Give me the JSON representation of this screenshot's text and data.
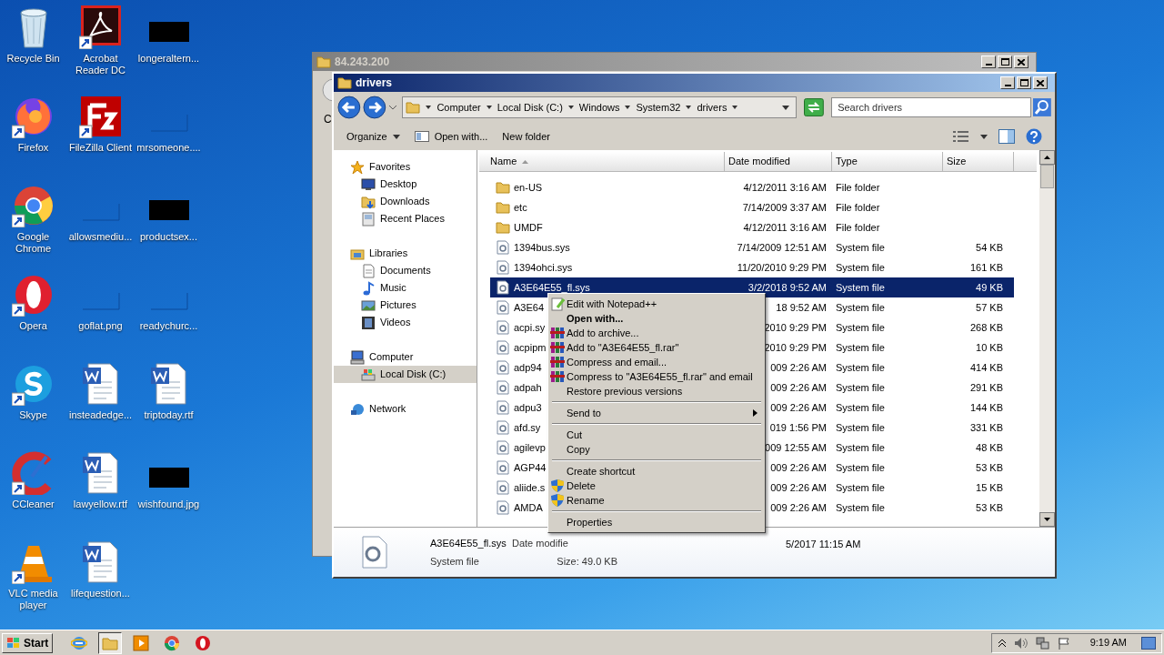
{
  "desktop": {
    "icons": [
      {
        "label": "Recycle Bin",
        "kind": "recycle",
        "shortcut": false
      },
      {
        "label": "Acrobat Reader DC",
        "kind": "acrobat",
        "shortcut": true
      },
      {
        "label": "longeraltern...",
        "kind": "black_thumbnail",
        "shortcut": false
      },
      {
        "label": "Firefox",
        "kind": "firefox",
        "shortcut": true
      },
      {
        "label": "FileZilla Client",
        "kind": "filezilla",
        "shortcut": true
      },
      {
        "label": "mrsomeone....",
        "kind": "blank_thumbnail",
        "shortcut": false
      },
      {
        "label": "Google Chrome",
        "kind": "chrome",
        "shortcut": true
      },
      {
        "label": "allowsmediu...",
        "kind": "blank_thumbnail",
        "shortcut": false
      },
      {
        "label": "productsex...",
        "kind": "black_thumbnail",
        "shortcut": false
      },
      {
        "label": "Opera",
        "kind": "opera",
        "shortcut": true
      },
      {
        "label": "goflat.png",
        "kind": "blank_thumbnail",
        "shortcut": false
      },
      {
        "label": "readychurc...",
        "kind": "blank_thumbnail",
        "shortcut": false
      },
      {
        "label": "Skype",
        "kind": "skype",
        "shortcut": true
      },
      {
        "label": "insteadedge...",
        "kind": "word",
        "shortcut": false
      },
      {
        "label": "triptoday.rtf",
        "kind": "word",
        "shortcut": false
      },
      {
        "label": "CCleaner",
        "kind": "ccleaner",
        "shortcut": true
      },
      {
        "label": "lawyellow.rtf",
        "kind": "word",
        "shortcut": false
      },
      {
        "label": "wishfound.jpg",
        "kind": "black_thumbnail",
        "shortcut": false
      },
      {
        "label": "VLC media player",
        "kind": "vlc",
        "shortcut": true
      },
      {
        "label": "lifequestion...",
        "kind": "word",
        "shortcut": false
      }
    ]
  },
  "back_window": {
    "title": "84.243.200",
    "fragment": "C"
  },
  "window": {
    "title": "drivers",
    "breadcrumb": [
      "Computer",
      "Local Disk (C:)",
      "Windows",
      "System32",
      "drivers"
    ],
    "search": {
      "placeholder": "Search drivers"
    },
    "toolbar": [
      {
        "label": "Organize",
        "kind": "menu"
      },
      {
        "label": "Open with...",
        "kind": "open"
      },
      {
        "label": "New folder",
        "kind": "plain"
      }
    ],
    "nav": [
      {
        "label": "Favorites",
        "kind": "favorites",
        "selected": false,
        "children": [
          {
            "label": "Desktop",
            "kind": "desktop",
            "selected": false
          },
          {
            "label": "Downloads",
            "kind": "downloads",
            "selected": false
          },
          {
            "label": "Recent Places",
            "kind": "recent",
            "selected": false
          }
        ]
      },
      {
        "label": "Libraries",
        "kind": "libraries",
        "selected": false,
        "children": [
          {
            "label": "Documents",
            "kind": "documents",
            "selected": false
          },
          {
            "label": "Music",
            "kind": "music",
            "selected": false
          },
          {
            "label": "Pictures",
            "kind": "pictures",
            "selected": false
          },
          {
            "label": "Videos",
            "kind": "videos",
            "selected": false
          }
        ]
      },
      {
        "label": "Computer",
        "kind": "computer",
        "selected": false,
        "children": [
          {
            "label": "Local Disk (C:)",
            "kind": "disk",
            "selected": true
          }
        ]
      },
      {
        "label": "Network",
        "kind": "network",
        "selected": false
      }
    ],
    "columns": [
      {
        "label": "Name",
        "sorted": true
      },
      {
        "label": "Date modified",
        "sorted": false
      },
      {
        "label": "Type",
        "sorted": false
      },
      {
        "label": "Size",
        "sorted": false
      }
    ],
    "rows": [
      {
        "name": "en-US",
        "date": "4/12/2011 3:16 AM",
        "type": "File folder",
        "kind": "folder",
        "selected": false
      },
      {
        "name": "etc",
        "date": "7/14/2009 3:37 AM",
        "type": "File folder",
        "kind": "folder",
        "selected": false
      },
      {
        "name": "UMDF",
        "date": "4/12/2011 3:16 AM",
        "type": "File folder",
        "kind": "folder",
        "selected": false
      },
      {
        "name": "1394bus.sys",
        "date": "7/14/2009 12:51 AM",
        "type": "System file",
        "size": "54 KB",
        "kind": "file",
        "selected": false
      },
      {
        "name": "1394ohci.sys",
        "date": "11/20/2010 9:29 PM",
        "type": "System file",
        "size": "161 KB",
        "kind": "file",
        "selected": false
      },
      {
        "name": "A3E64E55_fl.sys",
        "date": "3/2/2018 9:52 AM",
        "type": "System file",
        "size": "49 KB",
        "kind": "file",
        "selected": true
      },
      {
        "name": "A3E64",
        "date": "18 9:52 AM",
        "type": "System file",
        "size": "57 KB",
        "kind": "file",
        "selected": false
      },
      {
        "name": "acpi.sy",
        "date": "2010 9:29 PM",
        "type": "System file",
        "size": "268 KB",
        "kind": "file",
        "selected": false
      },
      {
        "name": "acpipm",
        "date": "2010 9:29 PM",
        "type": "System file",
        "size": "10 KB",
        "kind": "file",
        "selected": false
      },
      {
        "name": "adp94",
        "date": "009 2:26 AM",
        "type": "System file",
        "size": "414 KB",
        "kind": "file",
        "selected": false
      },
      {
        "name": "adpah",
        "date": "009 2:26 AM",
        "type": "System file",
        "size": "291 KB",
        "kind": "file",
        "selected": false
      },
      {
        "name": "adpu3",
        "date": "009 2:26 AM",
        "type": "System file",
        "size": "144 KB",
        "kind": "file",
        "selected": false
      },
      {
        "name": "afd.sy",
        "date": "019 1:56 PM",
        "type": "System file",
        "size": "331 KB",
        "kind": "file",
        "selected": false
      },
      {
        "name": "agilevp",
        "date": "009 12:55 AM",
        "type": "System file",
        "size": "48 KB",
        "kind": "file",
        "selected": false
      },
      {
        "name": "AGP44",
        "date": "009 2:26 AM",
        "type": "System file",
        "size": "53 KB",
        "kind": "file",
        "selected": false
      },
      {
        "name": "aliide.s",
        "date": "009 2:26 AM",
        "type": "System file",
        "size": "15 KB",
        "kind": "file",
        "selected": false
      },
      {
        "name": "AMDA",
        "date": "009 2:26 AM",
        "type": "System file",
        "size": "53 KB",
        "kind": "file",
        "selected": false
      }
    ],
    "details": {
      "name": "A3E64E55_fl.sys",
      "type": "System file",
      "date_label": "Date modifie",
      "size": "Size: 49.0 KB",
      "created_fragment": "5/2017 11:15 AM"
    }
  },
  "context_menu": [
    {
      "kind": "notepad",
      "label": "Edit with Notepad++",
      "bold": false
    },
    {
      "kind": "plain",
      "label": "Open with...",
      "bold": true
    },
    {
      "kind": "archive",
      "label": "Add to archive...",
      "bold": false
    },
    {
      "kind": "archive",
      "label": "Add to \"A3E64E55_fl.rar\"",
      "bold": false
    },
    {
      "kind": "archive",
      "label": "Compress and email...",
      "bold": false
    },
    {
      "kind": "archive",
      "label": "Compress to \"A3E64E55_fl.rar\" and email",
      "bold": false
    },
    {
      "kind": "plain",
      "label": "Restore previous versions",
      "bold": false
    },
    {
      "kind": "separator"
    },
    {
      "kind": "submenu",
      "label": "Send to",
      "bold": false
    },
    {
      "kind": "separator"
    },
    {
      "kind": "plain",
      "label": "Cut",
      "bold": false
    },
    {
      "kind": "plain",
      "label": "Copy",
      "bold": false
    },
    {
      "kind": "separator"
    },
    {
      "kind": "plain",
      "label": "Create shortcut",
      "bold": false
    },
    {
      "kind": "shield",
      "label": "Delete",
      "bold": false
    },
    {
      "kind": "shield",
      "label": "Rename",
      "bold": false
    },
    {
      "kind": "separator"
    },
    {
      "kind": "plain",
      "label": "Properties",
      "bold": false
    }
  ],
  "taskbar": {
    "start": "Start",
    "apps": [
      {
        "kind": "ie",
        "selected": false
      },
      {
        "kind": "explorer",
        "selected": true
      },
      {
        "kind": "media",
        "selected": false
      },
      {
        "kind": "chrome",
        "selected": false
      },
      {
        "kind": "opera",
        "selected": false
      }
    ],
    "clock": "9:19 AM"
  }
}
